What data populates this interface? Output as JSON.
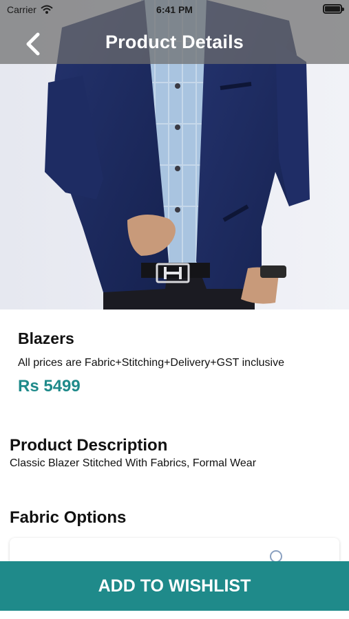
{
  "status_bar": {
    "carrier": "Carrier",
    "time": "6:41 PM",
    "wifi_icon": "wifi-icon",
    "battery_icon": "battery-icon"
  },
  "header": {
    "title": "Product Details",
    "back_icon": "chevron-left-icon"
  },
  "product": {
    "image_icon": "blazer-photo",
    "name": "Blazers",
    "price_note": "All prices are Fabric+Stitching+Delivery+GST inclusive",
    "price": "Rs 5499"
  },
  "description": {
    "title": "Product Description",
    "text": "Classic Blazer Stitched With Fabrics, Formal Wear"
  },
  "fabric_options": {
    "title": "Fabric Options"
  },
  "actions": {
    "wishlist_label": "ADD TO WISHLIST"
  },
  "colors": {
    "accent": "#1f8a8a",
    "header_overlay": "#6e6e6e",
    "blazer": "#1d2a5e",
    "shirt": "#a9c4e0"
  }
}
